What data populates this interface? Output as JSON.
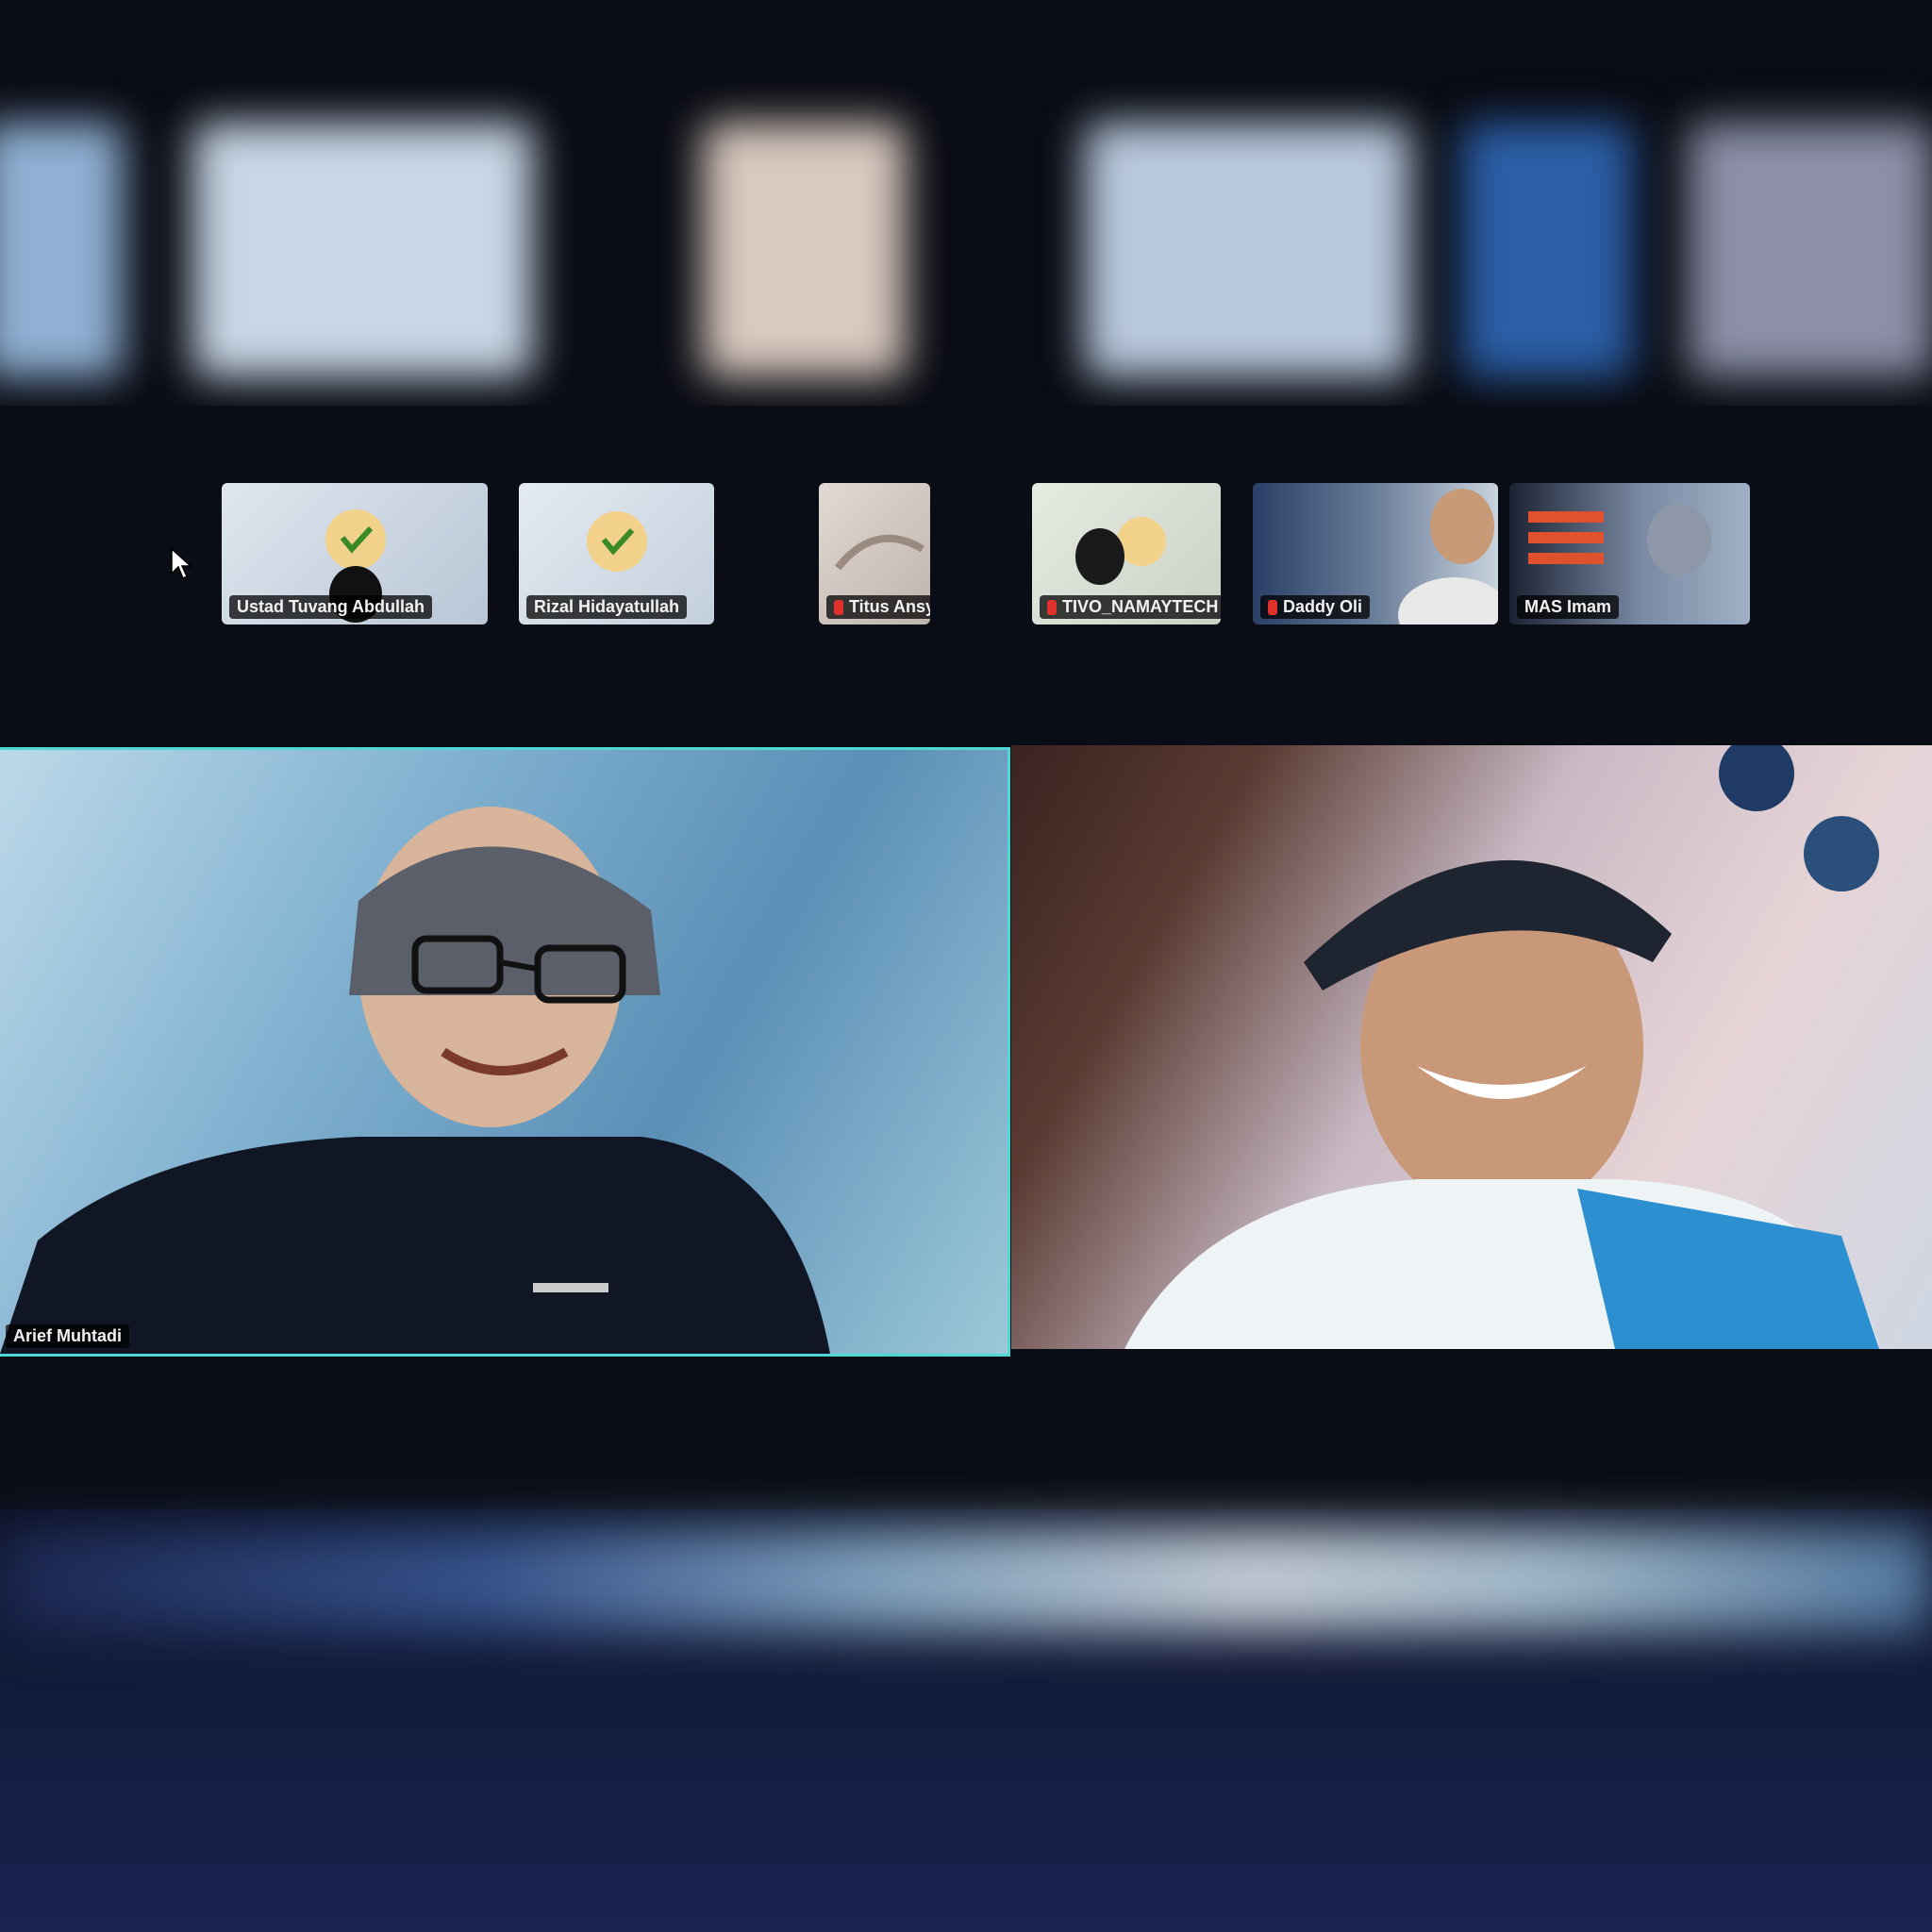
{
  "participants_strip": [
    {
      "name": "Ustad Tuvang Abdullah",
      "muted": false
    },
    {
      "name": "Rizal Hidayatullah",
      "muted": false
    },
    {
      "name": "Titus Ansy",
      "muted": true
    },
    {
      "name": "TIVO_NAMAYTECH B...",
      "muted": true
    },
    {
      "name": "Daddy Oli",
      "muted": false
    },
    {
      "name": "MAS Imam",
      "muted": false
    }
  ],
  "speakers": [
    {
      "name": "Arief Muhtadi"
    },
    {
      "name": ""
    }
  ]
}
